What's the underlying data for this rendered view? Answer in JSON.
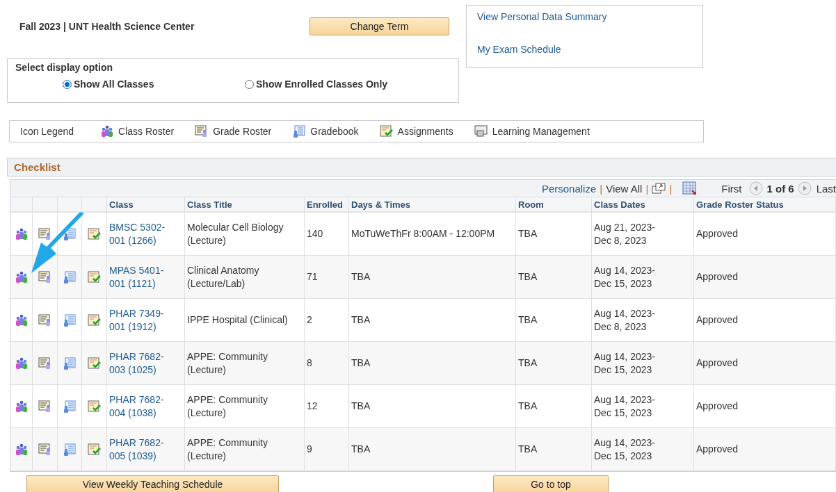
{
  "header": {
    "term": "Fall 2023 | UNT Health Science Center",
    "change_term_button": "Change Term"
  },
  "links": [
    "View Personal Data Summary",
    "My Exam Schedule"
  ],
  "display_option": {
    "title": "Select display option",
    "options": [
      {
        "label": "Show All Classes",
        "selected": true
      },
      {
        "label": "Show Enrolled Classes Only",
        "selected": false
      }
    ]
  },
  "icon_legend": {
    "title": "Icon Legend",
    "items": [
      {
        "kind": "class_roster",
        "label": "Class Roster"
      },
      {
        "kind": "grade_roster",
        "label": "Grade Roster"
      },
      {
        "kind": "gradebook",
        "label": "Gradebook"
      },
      {
        "kind": "assignments",
        "label": "Assignments"
      },
      {
        "kind": "learning_management",
        "label": "Learning Management"
      }
    ]
  },
  "checklist": {
    "title": "Checklist",
    "toolbar": {
      "personalize": "Personalize",
      "separator": "|",
      "view_all": "View All",
      "first": "First",
      "page": "1 of 6",
      "last": "Last"
    },
    "columns": [
      "Class",
      "Class Title",
      "Enrolled",
      "Days & Times",
      "Room",
      "Class Dates",
      "Grade Roster Status"
    ],
    "row_actions": [
      {
        "kind": "class_roster"
      },
      {
        "kind": "grade_roster"
      },
      {
        "kind": "gradebook"
      },
      {
        "kind": "assignments"
      }
    ],
    "rows": [
      {
        "class": "BMSC 5302-001",
        "section": "(1266)",
        "title": "Molecular Cell Biology (Lecture)",
        "enrolled": "140",
        "days_times": "MoTuWeThFr 8:00AM - 12:00PM",
        "room": "TBA",
        "dates": "Aug 21, 2023-Dec 8, 2023",
        "status": "Approved"
      },
      {
        "class": "MPAS 5401-001",
        "section": "(1121)",
        "title": "Clinical Anatomy (Lecture/Lab)",
        "enrolled": "71",
        "days_times": "TBA",
        "room": "TBA",
        "dates": "Aug 14, 2023-Dec 15, 2023",
        "status": "Approved"
      },
      {
        "class": "PHAR 7349-001",
        "section": "(1912)",
        "title": "IPPE Hospital (Clinical)",
        "enrolled": "2",
        "days_times": "TBA",
        "room": "TBA",
        "dates": "Aug 14, 2023-Dec 8, 2023",
        "status": "Approved"
      },
      {
        "class": "PHAR 7682-003",
        "section": "(1025)",
        "title": "APPE: Community (Lecture)",
        "enrolled": "8",
        "days_times": "TBA",
        "room": "TBA",
        "dates": "Aug 14, 2023-Dec 15, 2023",
        "status": "Approved"
      },
      {
        "class": "PHAR 7682-004",
        "section": "(1038)",
        "title": "APPE: Community (Lecture)",
        "enrolled": "12",
        "days_times": "TBA",
        "room": "TBA",
        "dates": "Aug 14, 2023-Dec 15, 2023",
        "status": "Approved"
      },
      {
        "class": "PHAR 7682-005",
        "section": "(1039)",
        "title": "APPE: Community (Lecture)",
        "enrolled": "9",
        "days_times": "TBA",
        "room": "TBA",
        "dates": "Aug 14, 2023-Dec 15, 2023",
        "status": "Approved"
      }
    ]
  },
  "bottom_buttons": [
    "View Weekly Teaching Schedule",
    "Go to top"
  ]
}
